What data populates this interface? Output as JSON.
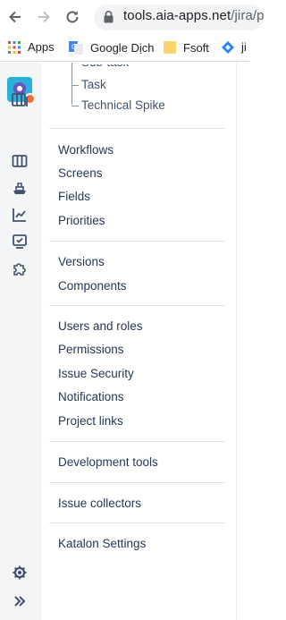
{
  "browser": {
    "url_host": "tools.aia-apps.net",
    "url_path": "/jira/p",
    "back_icon": "back-arrow-icon",
    "forward_icon": "forward-arrow-icon",
    "reload_icon": "reload-icon"
  },
  "bookmarks": [
    {
      "label": "Apps",
      "icon": "apps-grid-icon"
    },
    {
      "label": "Google Dịch",
      "icon": "google-translate-icon"
    },
    {
      "label": "Fsoft",
      "icon": "folder-icon"
    },
    {
      "label": "ji",
      "icon": "jira-icon"
    }
  ],
  "rail": {
    "icons": [
      "project-avatar",
      "board-icon",
      "columns-icon",
      "releases-icon",
      "reports-icon",
      "issues-icon",
      "add-ons-icon",
      "settings-icon",
      "expand-icon"
    ],
    "accent": "#2cb0d5"
  },
  "sidebar": {
    "issue_types": [
      "Sub-task",
      "Task",
      "Technical Spike"
    ],
    "group1": [
      "Workflows",
      "Screens",
      "Fields",
      "Priorities"
    ],
    "group2": [
      "Versions",
      "Components"
    ],
    "group3": [
      "Users and roles",
      "Permissions",
      "Issue Security",
      "Notifications",
      "Project links"
    ],
    "group4": [
      "Development tools"
    ],
    "group5": [
      "Issue collectors"
    ],
    "group6": [
      "Katalon Settings"
    ]
  }
}
